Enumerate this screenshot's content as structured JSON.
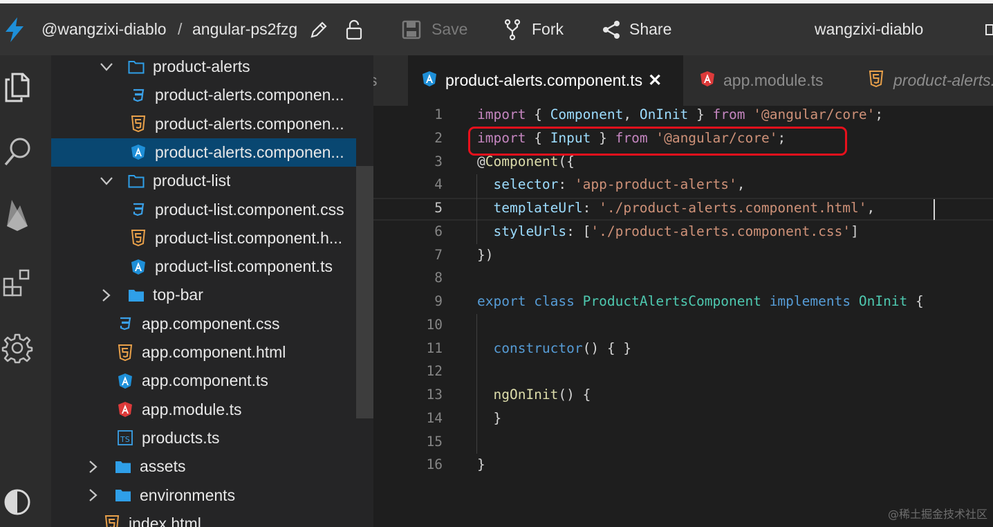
{
  "header": {
    "owner": "@wangzixi-diablo",
    "separator": "/",
    "project": "angular-ps2fzg",
    "save_label": "Save",
    "fork_label": "Fork",
    "share_label": "Share",
    "username": "wangzixi-diablo"
  },
  "sidebar": {
    "rows": [
      {
        "label": "product-alerts",
        "kind": "folder-open",
        "depth": 1
      },
      {
        "label": "product-alerts.componen...",
        "kind": "css",
        "depth": 2
      },
      {
        "label": "product-alerts.componen...",
        "kind": "html",
        "depth": 2
      },
      {
        "label": "product-alerts.componen...",
        "kind": "angular-ts",
        "depth": 2,
        "selected": true
      },
      {
        "label": "product-list",
        "kind": "folder-open",
        "depth": 1
      },
      {
        "label": "product-list.component.css",
        "kind": "css",
        "depth": 2
      },
      {
        "label": "product-list.component.h...",
        "kind": "html",
        "depth": 2
      },
      {
        "label": "product-list.component.ts",
        "kind": "angular-ts",
        "depth": 2
      },
      {
        "label": "top-bar",
        "kind": "folder-closed",
        "depth": 1
      },
      {
        "label": "app.component.css",
        "kind": "css",
        "depth": 1
      },
      {
        "label": "app.component.html",
        "kind": "html",
        "depth": 1
      },
      {
        "label": "app.component.ts",
        "kind": "angular-ts",
        "depth": 1
      },
      {
        "label": "app.module.ts",
        "kind": "angular-module",
        "depth": 1
      },
      {
        "label": "products.ts",
        "kind": "ts",
        "depth": 1
      },
      {
        "label": "assets",
        "kind": "folder-closed",
        "depth": 0
      },
      {
        "label": "environments",
        "kind": "folder-closed",
        "depth": 0
      },
      {
        "label": "index.html",
        "kind": "html",
        "depth": 0
      }
    ]
  },
  "tabs": {
    "partial_left": "s",
    "active": "product-alerts.component.ts",
    "second": "app.module.ts",
    "third": "product-alerts."
  },
  "editor": {
    "lines": [
      {
        "n": "1",
        "tokens": [
          [
            "kw",
            "import"
          ],
          [
            "p",
            " { "
          ],
          [
            "id",
            "Component"
          ],
          [
            "p",
            ", "
          ],
          [
            "id",
            "OnInit"
          ],
          [
            "p",
            " } "
          ],
          [
            "kw",
            "from"
          ],
          [
            "p",
            " "
          ],
          [
            "str",
            "'@angular/core'"
          ],
          [
            "p",
            ";"
          ]
        ]
      },
      {
        "n": "2",
        "tokens": [
          [
            "kw",
            "import"
          ],
          [
            "p",
            " { "
          ],
          [
            "id",
            "Input"
          ],
          [
            "p",
            " } "
          ],
          [
            "kw",
            "from"
          ],
          [
            "p",
            " "
          ],
          [
            "str",
            "'@angular/core'"
          ],
          [
            "p",
            ";"
          ]
        ]
      },
      {
        "n": "3",
        "tokens": [
          [
            "p",
            "@"
          ],
          [
            "fn",
            "Component"
          ],
          [
            "p",
            "({"
          ]
        ]
      },
      {
        "n": "4",
        "tokens": [
          [
            "p",
            "  "
          ],
          [
            "prop",
            "selector"
          ],
          [
            "p",
            ": "
          ],
          [
            "str",
            "'app-product-alerts'"
          ],
          [
            "p",
            ","
          ]
        ]
      },
      {
        "n": "5",
        "tokens": [
          [
            "p",
            "  "
          ],
          [
            "prop",
            "templateUrl"
          ],
          [
            "p",
            ": "
          ],
          [
            "str",
            "'./product-alerts.component.html'"
          ],
          [
            "p",
            ","
          ]
        ]
      },
      {
        "n": "6",
        "tokens": [
          [
            "p",
            "  "
          ],
          [
            "prop",
            "styleUrls"
          ],
          [
            "p",
            ": ["
          ],
          [
            "str",
            "'./product-alerts.component.css'"
          ],
          [
            "p",
            "]"
          ]
        ]
      },
      {
        "n": "7",
        "tokens": [
          [
            "p",
            "})"
          ]
        ]
      },
      {
        "n": "8",
        "tokens": []
      },
      {
        "n": "9",
        "tokens": [
          [
            "kw2",
            "export"
          ],
          [
            "p",
            " "
          ],
          [
            "kw2",
            "class"
          ],
          [
            "p",
            " "
          ],
          [
            "cls",
            "ProductAlertsComponent"
          ],
          [
            "p",
            " "
          ],
          [
            "kw2",
            "implements"
          ],
          [
            "p",
            " "
          ],
          [
            "cls",
            "OnInit"
          ],
          [
            "p",
            " {"
          ]
        ]
      },
      {
        "n": "10",
        "tokens": []
      },
      {
        "n": "11",
        "tokens": [
          [
            "p",
            "  "
          ],
          [
            "kw2",
            "constructor"
          ],
          [
            "p",
            "() { }"
          ]
        ]
      },
      {
        "n": "12",
        "tokens": []
      },
      {
        "n": "13",
        "tokens": [
          [
            "p",
            "  "
          ],
          [
            "fn",
            "ngOnInit"
          ],
          [
            "p",
            "() {"
          ]
        ]
      },
      {
        "n": "14",
        "tokens": [
          [
            "p",
            "  }"
          ]
        ]
      },
      {
        "n": "15",
        "tokens": []
      },
      {
        "n": "16",
        "tokens": [
          [
            "p",
            "}"
          ]
        ]
      }
    ],
    "current_line": "5"
  },
  "watermark": "@稀土掘金技术社区",
  "colors": {
    "header_bg": "#333333",
    "sidebar_bg": "#252526",
    "selection": "#094771",
    "editor_bg": "#1e1e1e",
    "highlight_border": "#e8101c",
    "angular_blue": "#1e8fd8",
    "angular_red": "#dd3a3a",
    "html_orange": "#e8a04a",
    "css_blue": "#3aa0e8",
    "folder_blue": "#2f9fe8"
  }
}
